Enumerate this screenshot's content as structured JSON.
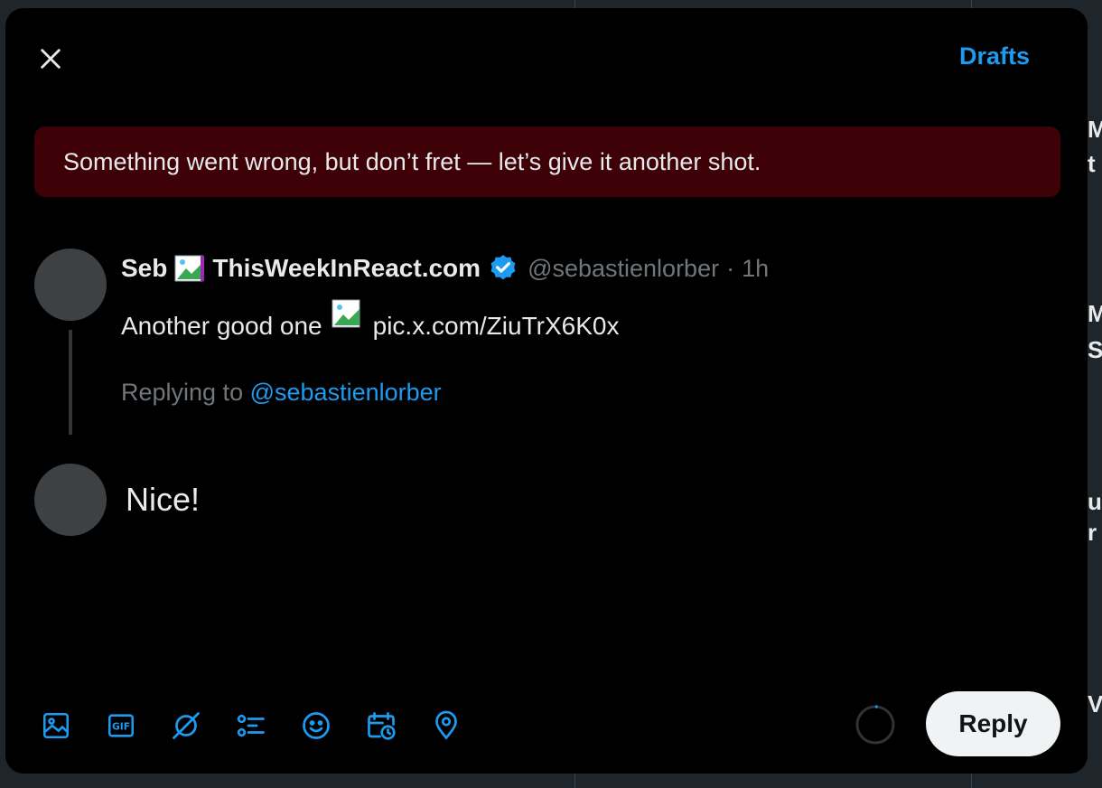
{
  "header": {
    "close_icon": "close-icon",
    "drafts_label": "Drafts"
  },
  "error_banner": {
    "message": "Something went wrong, but don’t fret — let’s give it another shot."
  },
  "original_tweet": {
    "display_name_first": "Seb",
    "display_name_second": "ThisWeekInReact.com",
    "verified": true,
    "handle": "@sebastienlorber",
    "separator": "·",
    "time_ago": "1h",
    "text_before_image": "Another good one",
    "link_text": "pic.x.com/ZiuTrX6K0x",
    "replying_prefix": "Replying to",
    "replying_mention": "@sebastienlorber"
  },
  "compose": {
    "text": "Nice!"
  },
  "toolbar": {
    "icons": [
      "image-icon",
      "gif-icon",
      "grok-icon",
      "poll-icon",
      "emoji-icon",
      "schedule-icon",
      "location-icon"
    ]
  },
  "actions": {
    "reply_label": "Reply"
  },
  "colors": {
    "accent": "#1d9bf0",
    "error_bg": "#3d0107",
    "text_primary": "#e7e9ea",
    "text_secondary": "#71767b"
  },
  "background": {
    "peek_lines": [
      "M",
      "t",
      "M",
      "S",
      "u",
      "r",
      "V"
    ]
  }
}
